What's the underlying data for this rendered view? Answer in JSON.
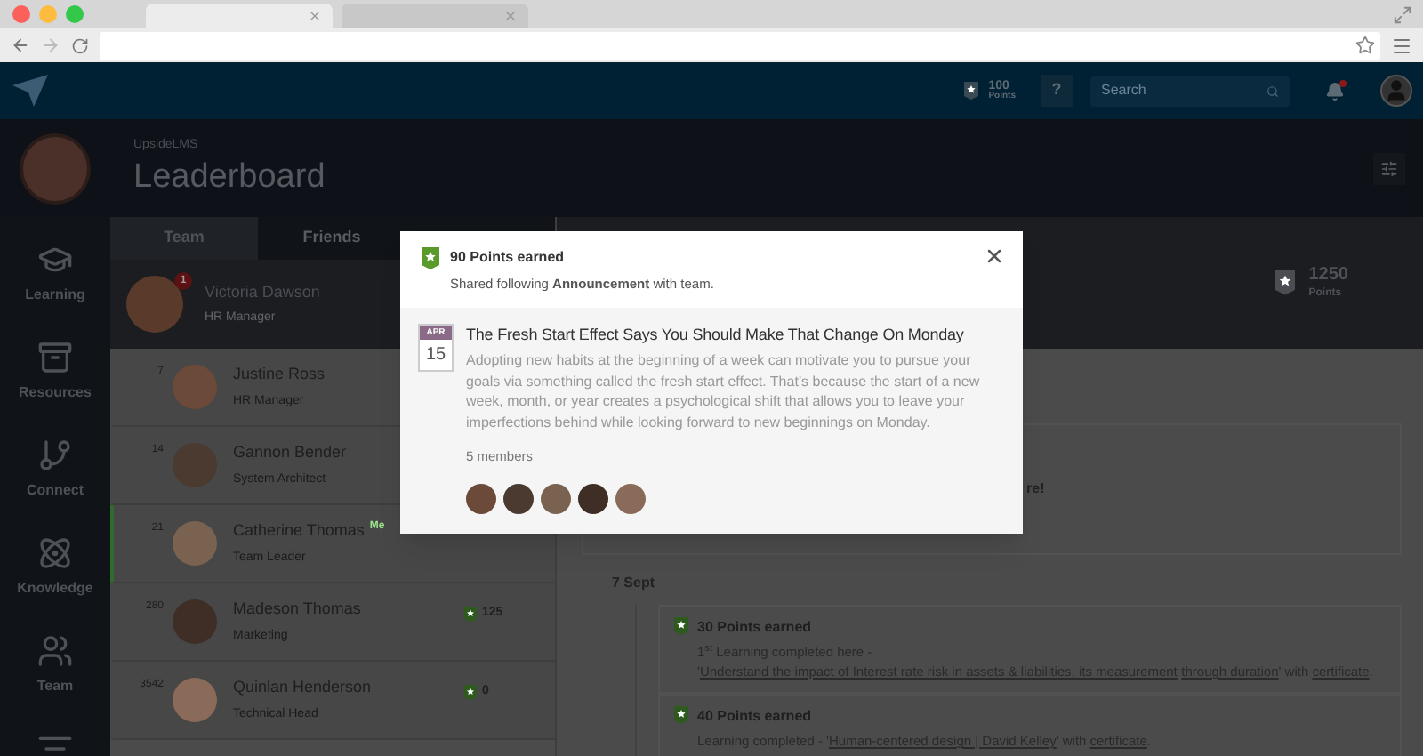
{
  "browser": {
    "tabs": [
      {
        "selected": true
      },
      {
        "selected": false
      }
    ]
  },
  "app_bar": {
    "points": "100",
    "points_label": "Points",
    "help": "?",
    "search": {
      "placeholder": "Search"
    },
    "unread": true
  },
  "header": {
    "org": "UpsideLMS",
    "title": "Leaderboard"
  },
  "sidebar": {
    "items": [
      {
        "kind": "learning",
        "label": "Learning"
      },
      {
        "kind": "resources",
        "label": "Resources"
      },
      {
        "kind": "connect",
        "label": "Connect"
      },
      {
        "kind": "knowledge",
        "label": "Knowledge"
      },
      {
        "kind": "team",
        "label": "Team"
      },
      {
        "kind": "filter"
      }
    ]
  },
  "tabs": [
    {
      "label": "Team",
      "selected": true
    },
    {
      "label": "Friends",
      "selected": false
    }
  ],
  "my_profile": {
    "name": "Victoria Dawson",
    "role": "HR Manager",
    "badge": "1",
    "points": "1250",
    "points_label": "Points"
  },
  "leaderboard": [
    {
      "rank": "7",
      "name": "Justine Ross",
      "role": "HR Manager",
      "selected": false
    },
    {
      "rank": "14",
      "name": "Gannon Bender",
      "role": "System Architect",
      "selected": false
    },
    {
      "rank": "21",
      "name": "Catherine Thomas",
      "tag": "Me",
      "role": "Team Leader",
      "selected": true
    },
    {
      "rank": "280",
      "name": "Madeson Thomas",
      "role": "Marketing",
      "points": "125",
      "selected": false
    },
    {
      "rank": "3542",
      "name": "Quinlan Henderson",
      "role": "Technical Head",
      "points": "0",
      "selected": false
    }
  ],
  "feed": {
    "partial_text": "re!",
    "date": "7 Sept",
    "items": [
      {
        "title": "30 Points earned",
        "segments": [
          {
            "text": "1$^{st}$ Learning completed here - '",
            "link": false
          },
          {
            "text": "Understand the impact of Interest rate risk in assets & liabilities, its measurement",
            "link": true
          },
          {
            "text": "through duration",
            "link": true
          },
          {
            "text": "' with ",
            "link": false
          },
          {
            "text": "certificate",
            "link": true
          },
          {
            "text": ".",
            "link": false
          }
        ]
      },
      {
        "title": "40 Points earned",
        "segments": [
          {
            "text": "Learning completed - '",
            "link": false
          },
          {
            "text": "Human-centered design | David Kelley",
            "link": true
          },
          {
            "text": "' with ",
            "link": false
          },
          {
            "text": "certificate",
            "link": true
          },
          {
            "text": ".",
            "link": false
          }
        ]
      }
    ]
  },
  "modal": {
    "points": "90 Points earned",
    "subtitle": "Shared following **Announcement** with team.",
    "month": "APR",
    "day": "15",
    "title": "The Fresh Start Effect Says You Should Make That Change On Monday",
    "body": "Adopting new habits at the beginning of a week can motivate you to pursue your goals via something called the fresh start effect. That’s because the start of a new week, month, or year creates a psychological shift that allows you to leave your imperfections behind while looking forward to new beginnings on Monday.",
    "members_label": "5 members"
  }
}
